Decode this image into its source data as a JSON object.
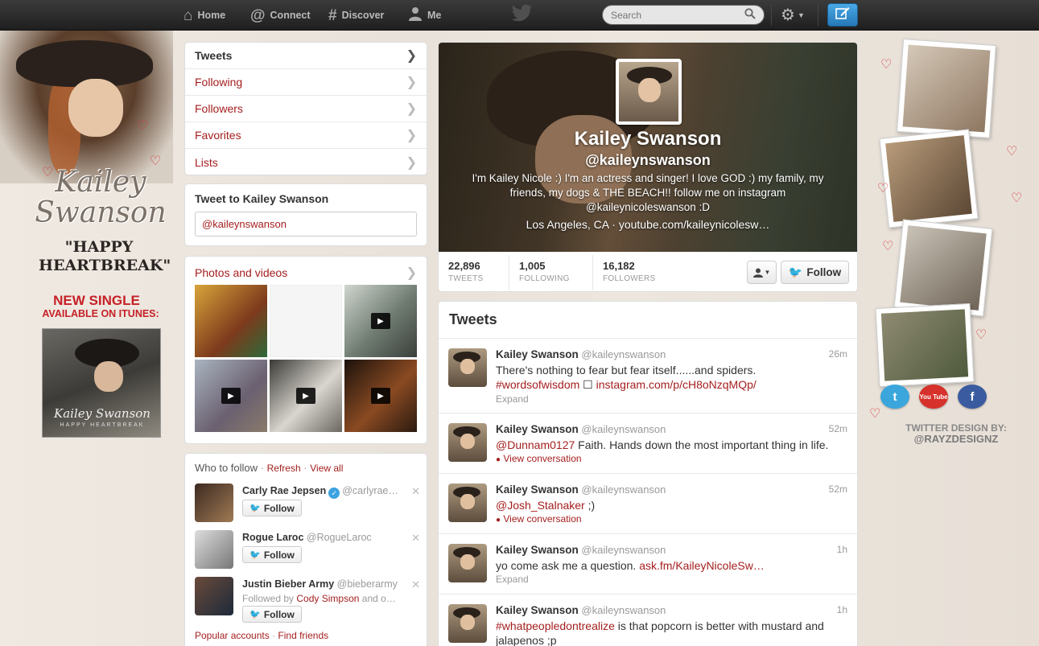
{
  "topbar": {
    "nav": [
      {
        "label": "Home",
        "icon": "home-icon"
      },
      {
        "label": "Connect",
        "icon": "at-icon"
      },
      {
        "label": "Discover",
        "icon": "hash-icon"
      },
      {
        "label": "Me",
        "icon": "person-icon"
      }
    ],
    "search_placeholder": "Search",
    "accent": "#2678b6"
  },
  "left_deco": {
    "artist_logo": "Kailey Swanson",
    "single_title": "\"HAPPY HEARTBREAK\"",
    "new_single": "NEW SINGLE",
    "available": "AVAILABLE ON ITUNES:",
    "album_name": "Kailey Swanson",
    "album_sub": "HAPPY HEARTBREAK"
  },
  "nav_list": [
    {
      "label": "Tweets",
      "active": true
    },
    {
      "label": "Following"
    },
    {
      "label": "Followers"
    },
    {
      "label": "Favorites"
    },
    {
      "label": "Lists"
    }
  ],
  "tweet_to": {
    "title": "Tweet to Kailey Swanson",
    "value": "@kaileynswanson"
  },
  "media": {
    "title": "Photos and videos"
  },
  "who_to_follow": {
    "title": "Who to follow",
    "refresh": "Refresh",
    "view_all": "View all",
    "users": [
      {
        "name": "Carly Rae Jepsen",
        "screen_name": "@carlyrae…",
        "verified": true,
        "follow_label": "Follow"
      },
      {
        "name": "Rogue Laroc",
        "screen_name": "@RogueLaroc",
        "follow_label": "Follow"
      },
      {
        "name": "Justin Bieber Army",
        "screen_name": "@bieberarmy",
        "followed_by_prefix": "Followed by",
        "followed_by_name": "Cody Simpson",
        "followed_by_suffix": "and o…",
        "follow_label": "Follow"
      }
    ],
    "popular_accounts": "Popular accounts",
    "find_friends": "Find friends"
  },
  "profile": {
    "name": "Kailey Swanson",
    "handle": "@kaileynswanson",
    "bio": "I'm Kailey Nicole :) I'm an actress and singer! I love GOD :) my family, my  friends, my dogs & THE BEACH!! follow me on instagram @kaileynicoleswanson :D",
    "location": "Los Angeles, CA",
    "website": "youtube.com/kaileynicolesw…",
    "stats": [
      {
        "value": "22,896",
        "label": "TWEETS"
      },
      {
        "value": "1,005",
        "label": "FOLLOWING"
      },
      {
        "value": "16,182",
        "label": "FOLLOWERS"
      }
    ],
    "follow_label": "Follow"
  },
  "stream": {
    "title": "Tweets",
    "tweets": [
      {
        "name": "Kailey Swanson",
        "screen_name": "@kaileynswanson",
        "time": "26m",
        "text": "There's nothing to fear but fear itself......and spiders.",
        "hashtag": "#wordsofwisdom",
        "link": "instagram.com/p/cH8oNzqMQp/",
        "action": "Expand"
      },
      {
        "name": "Kailey Swanson",
        "screen_name": "@kaileynswanson",
        "time": "52m",
        "mention": "@Dunnam0127",
        "text": " Faith. Hands down the most important thing in life.",
        "action": "View conversation"
      },
      {
        "name": "Kailey Swanson",
        "screen_name": "@kaileynswanson",
        "time": "52m",
        "mention": "@Josh_Stalnaker",
        "text": " ;)",
        "action": "View conversation"
      },
      {
        "name": "Kailey Swanson",
        "screen_name": "@kaileynswanson",
        "time": "1h",
        "text": "yo come ask me a question. ",
        "link": "ask.fm/KaileyNicoleSw…",
        "action": "Expand"
      },
      {
        "name": "Kailey Swanson",
        "screen_name": "@kaileynswanson",
        "time": "1h",
        "hashtag": "#whatpeopledontrealize",
        "text": " is that popcorn is better with mustard and jalapenos ;p"
      }
    ]
  },
  "right_deco": {
    "credit_line": "TWITTER DESIGN BY:",
    "credit_handle": "@RAYZDESIGNZ",
    "social": [
      "twitter-icon",
      "youtube-icon",
      "facebook-icon"
    ],
    "youtube_label": "You Tube"
  }
}
